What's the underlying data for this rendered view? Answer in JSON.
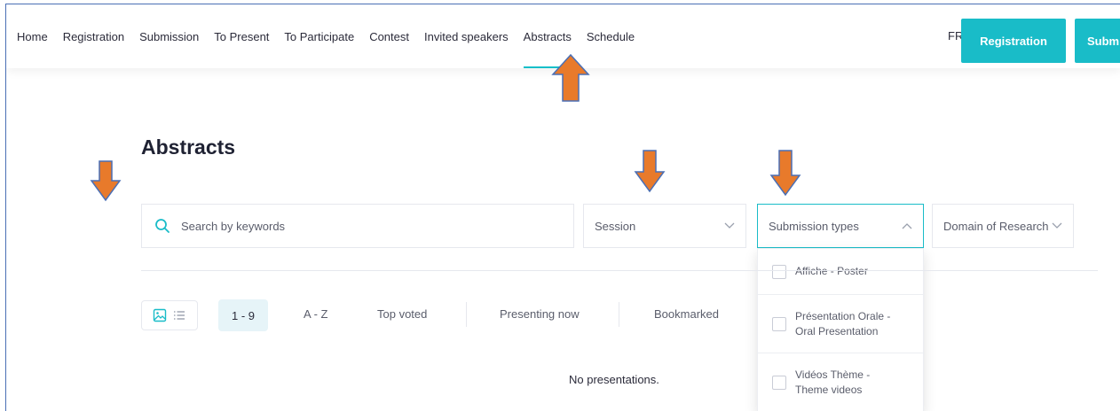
{
  "nav": {
    "items": [
      "Home",
      "Registration",
      "Submission",
      "To Present",
      "To Participate",
      "Contest",
      "Invited speakers",
      "Abstracts",
      "Schedule"
    ],
    "active": "Abstracts",
    "lang": "FR",
    "registration_button": "Registration",
    "submit_button": "Subm"
  },
  "page": {
    "title": "Abstracts"
  },
  "filters": {
    "search_placeholder": "Search by keywords",
    "session_label": "Session",
    "submission_types_label": "Submission types",
    "domain_label": "Domain of Research",
    "submission_type_options": [
      {
        "line1": "Affiche - Poster",
        "line2": ""
      },
      {
        "line1": "Présentation Orale -",
        "line2": "Oral Presentation"
      },
      {
        "line1": "Vidéos Thème -",
        "line2": "Theme videos"
      }
    ]
  },
  "sort": {
    "range": "1 - 9",
    "az": "A - Z",
    "top_voted": "Top voted",
    "presenting_now": "Presenting now",
    "bookmarked": "Bookmarked"
  },
  "empty_message": "No presentations.",
  "colors": {
    "accent": "#19bcc8",
    "annotation_arrow": "#e87a2b",
    "arrow_outline": "#4a6fb5"
  },
  "icons": [
    "search-icon",
    "chevron-down-icon",
    "chevron-up-icon",
    "image-view-icon",
    "list-view-icon",
    "annotation-arrow-up",
    "annotation-arrow-down"
  ]
}
